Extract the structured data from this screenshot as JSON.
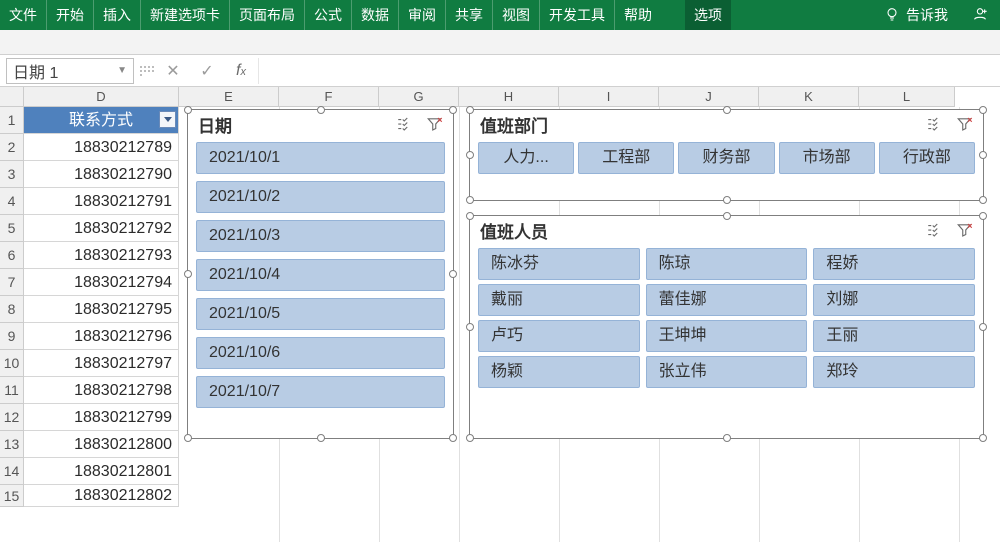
{
  "ribbon": {
    "tabs": [
      "文件",
      "开始",
      "插入",
      "新建选项卡",
      "页面布局",
      "公式",
      "数据",
      "审阅",
      "共享",
      "视图",
      "开发工具",
      "帮助"
    ],
    "contextual": "选项",
    "tell_me": "告诉我"
  },
  "namebox": {
    "value": "日期 1"
  },
  "formula": {
    "value": ""
  },
  "columns": [
    "D",
    "E",
    "F",
    "G",
    "H",
    "I",
    "J",
    "K",
    "L"
  ],
  "rows": [
    "1",
    "2",
    "3",
    "4",
    "5",
    "6",
    "7",
    "8",
    "9",
    "10",
    "11",
    "12",
    "13",
    "14",
    "15"
  ],
  "table": {
    "header": "联系方式",
    "values": [
      "18830212789",
      "18830212790",
      "18830212791",
      "18830212792",
      "18830212793",
      "18830212794",
      "18830212795",
      "18830212796",
      "18830212797",
      "18830212798",
      "18830212799",
      "18830212800",
      "18830212801",
      "18830212802"
    ]
  },
  "slicers": {
    "date": {
      "title": "日期",
      "items": [
        "2021/10/1",
        "2021/10/2",
        "2021/10/3",
        "2021/10/4",
        "2021/10/5",
        "2021/10/6",
        "2021/10/7"
      ]
    },
    "dept": {
      "title": "值班部门",
      "items": [
        "人力...",
        "工程部",
        "财务部",
        "市场部",
        "行政部"
      ]
    },
    "person": {
      "title": "值班人员",
      "items": [
        "陈冰芬",
        "陈琼",
        "程娇",
        "戴丽",
        "蕾佳娜",
        "刘娜",
        "卢巧",
        "王坤坤",
        "王丽",
        "杨颖",
        "张立伟",
        "郑玲"
      ]
    }
  }
}
